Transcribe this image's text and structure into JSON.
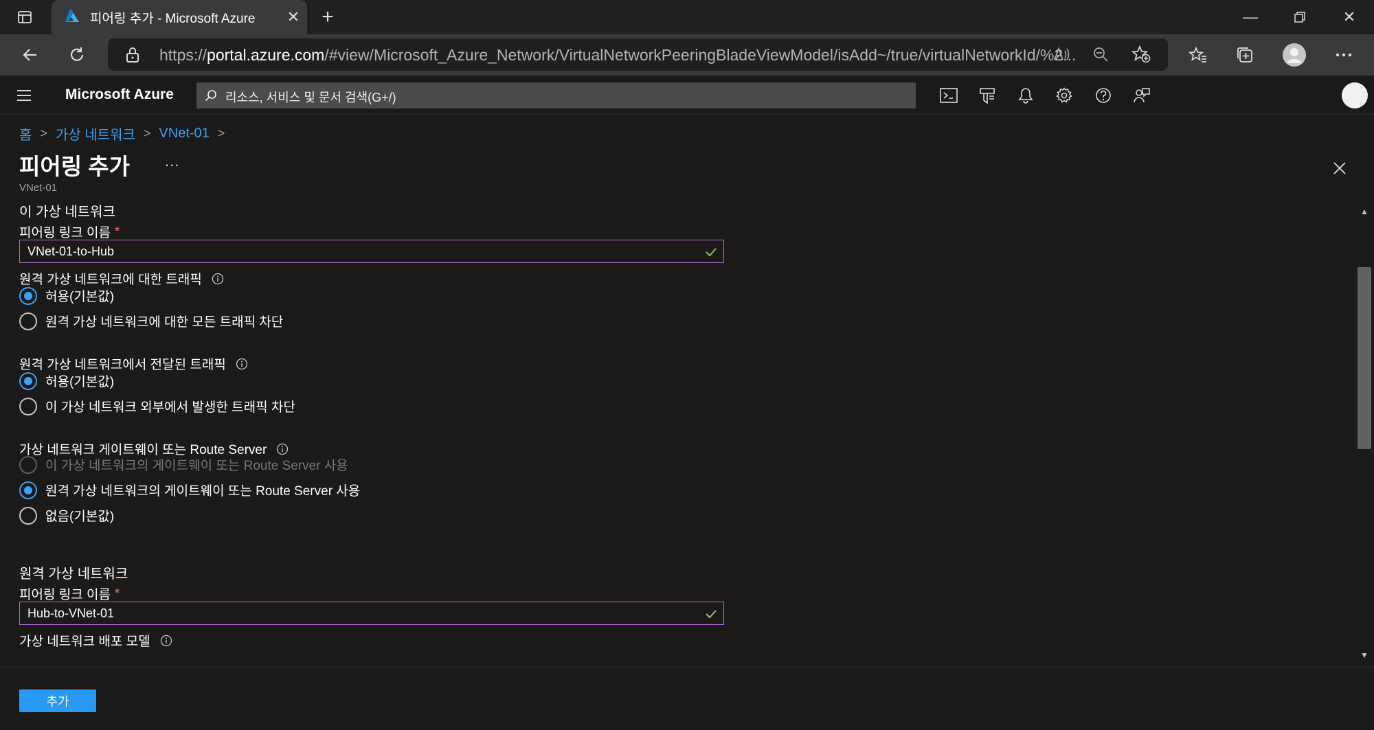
{
  "browser": {
    "tab_title": "피어링 추가 - Microsoft Azure",
    "url_prefix": "https://",
    "url_host": "portal.azure.com",
    "url_path": "/#view/Microsoft_Azure_Network/VirtualNetworkPeeringBladeViewModel/isAdd~/true/virtualNetworkId/%2..."
  },
  "azure": {
    "brand": "Microsoft Azure",
    "search_placeholder": "리소스, 서비스 및 문서 검색(G+/)"
  },
  "breadcrumb": {
    "items": [
      "홈",
      "가상 네트워크",
      "VNet-01"
    ]
  },
  "page": {
    "title": "피어링 추가",
    "more": "...",
    "subtitle": "VNet-01"
  },
  "form": {
    "local_section": "이 가상 네트워크",
    "local_link_label": "피어링 링크 이름",
    "local_link_value": "VNet-01-to-Hub",
    "required_mark": "*",
    "traffic_to_remote": {
      "label": "원격 가상 네트워크에 대한 트래픽",
      "options": [
        "허용(기본값)",
        "원격 가상 네트워크에 대한 모든 트래픽 차단"
      ],
      "selected": 0
    },
    "forwarded_traffic": {
      "label": "원격 가상 네트워크에서 전달된 트래픽",
      "options": [
        "허용(기본값)",
        "이 가상 네트워크 외부에서 발생한 트래픽 차단"
      ],
      "selected": 0
    },
    "gateway": {
      "label": "가상 네트워크 게이트웨이 또는 Route Server",
      "options": [
        "이 가상 네트워크의 게이트웨이 또는 Route Server 사용",
        "원격 가상 네트워크의 게이트웨이 또는 Route Server 사용",
        "없음(기본값)"
      ],
      "selected": 1,
      "disabled_index": 0
    },
    "remote_section": "원격 가상 네트워크",
    "remote_link_label": "피어링 링크 이름",
    "remote_link_value": "Hub-to-VNet-01",
    "deploy_model_label": "가상 네트워크 배포 모델"
  },
  "footer": {
    "add_label": "추가"
  },
  "colors": {
    "accent": "#2899f5",
    "link": "#3aa0f3",
    "input_border": "#b36bd9",
    "check": "#92c353",
    "required": "#f1707b"
  }
}
